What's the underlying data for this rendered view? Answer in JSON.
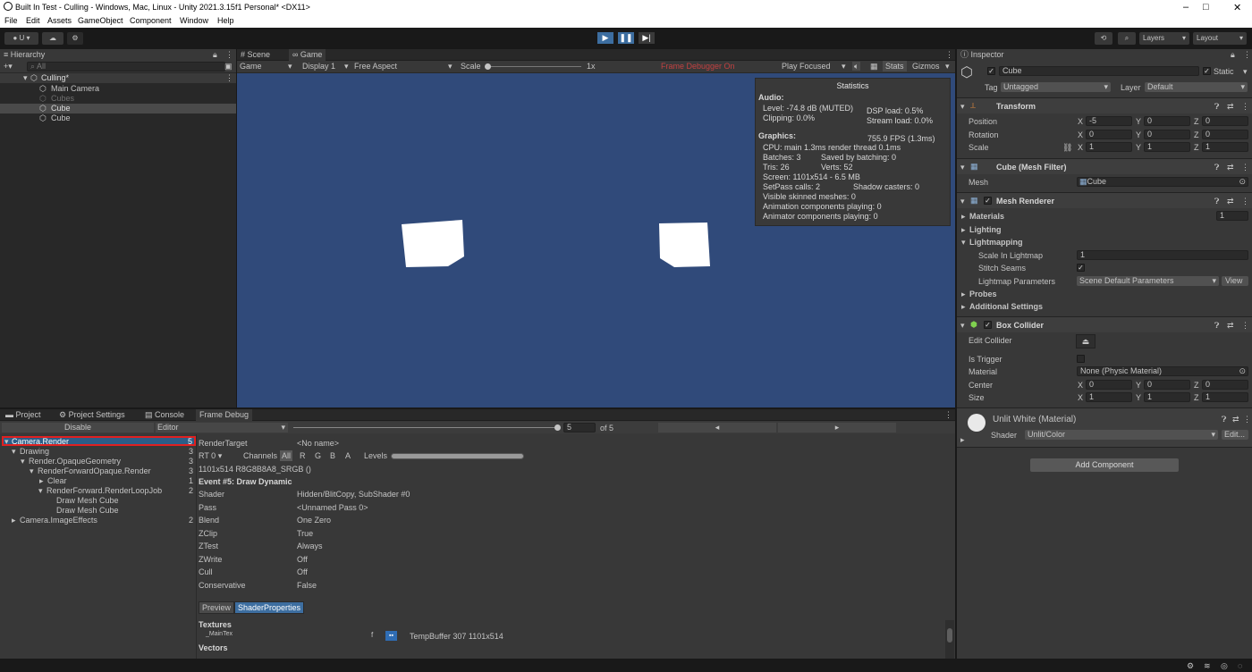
{
  "window": {
    "title": "Built In Test - Culling - Windows, Mac, Linux - Unity 2021.3.15f1 Personal* <DX11>",
    "minimize": "–",
    "maximize": "□",
    "close": "✕"
  },
  "menu": [
    "File",
    "Edit",
    "Assets",
    "GameObject",
    "Component",
    "Window",
    "Help"
  ],
  "toolbar": {
    "account": "U ▾",
    "layers": "Layers",
    "layout": "Layout"
  },
  "hierarchy": {
    "tab": "Hierarchy",
    "search_placeholder": "All",
    "scene": "Culling*",
    "items": [
      "Main Camera",
      "Cubes",
      "Cube",
      "Cube"
    ]
  },
  "game": {
    "tabs": [
      "Scene",
      "Game"
    ],
    "display_mode": "Game",
    "display": "Display 1",
    "aspect": "Free Aspect",
    "scale_label": "Scale",
    "scale_value": "1x",
    "frame_debugger": "Frame Debugger On",
    "play_focused": "Play Focused",
    "stats_btn": "Stats",
    "gizmos_btn": "Gizmos",
    "bg_color": "#304a7a"
  },
  "stats": {
    "title": "Statistics",
    "audio_h": "Audio:",
    "level": "Level: -74.8 dB (MUTED)",
    "clipping": "Clipping: 0.0%",
    "dsp": "DSP load: 0.5%",
    "stream": "Stream load: 0.0%",
    "graphics_h": "Graphics:",
    "fps": "755.9 FPS (1.3ms)",
    "cpu": "CPU: main 1.3ms  render thread 0.1ms",
    "batches": "Batches: 3",
    "saved": "Saved by batching: 0",
    "tris": "Tris: 26",
    "verts": "Verts: 52",
    "screen": "Screen: 1101x514 - 6.5 MB",
    "setpass": "SetPass calls: 2",
    "shadow": "Shadow casters: 0",
    "skinned": "Visible skinned meshes: 0",
    "anim": "Animation components playing: 0",
    "animator": "Animator components playing: 0"
  },
  "bottom_tabs": [
    "Project",
    "Project Settings",
    "Console",
    "Frame Debug"
  ],
  "frame_debug": {
    "disable": "Disable",
    "editor": "Editor",
    "slider_value": "5",
    "of_total": "of 5",
    "prev": "◂",
    "next": "▸",
    "tree": [
      {
        "label": "Camera.Render",
        "count": "5"
      },
      {
        "label": "Drawing",
        "count": "3"
      },
      {
        "label": "Render.OpaqueGeometry",
        "count": "3"
      },
      {
        "label": "RenderForwardOpaque.Render",
        "count": "3"
      },
      {
        "label": "Clear",
        "count": "1"
      },
      {
        "label": "RenderForward.RenderLoopJob",
        "count": "2"
      },
      {
        "label": "Draw Mesh Cube",
        "count": ""
      },
      {
        "label": "Draw Mesh Cube",
        "count": ""
      },
      {
        "label": "Camera.ImageEffects",
        "count": "2"
      }
    ],
    "rendertarget_label": "RenderTarget",
    "rendertarget_value": "<No name>",
    "rt": "RT 0",
    "channels": "Channels",
    "ch_all": "All",
    "ch_r": "R",
    "ch_g": "G",
    "ch_b": "B",
    "ch_a": "A",
    "levels": "Levels",
    "format": "1101x514 R8G8B8A8_SRGB ()",
    "event": "Event #5: Draw Dynamic",
    "props": [
      {
        "k": "Shader",
        "v": "Hidden/BlitCopy, SubShader #0"
      },
      {
        "k": "Pass",
        "v": "<Unnamed Pass 0>"
      },
      {
        "k": "Blend",
        "v": "One Zero"
      },
      {
        "k": "ZClip",
        "v": "True"
      },
      {
        "k": "ZTest",
        "v": "Always"
      },
      {
        "k": "ZWrite",
        "v": "Off"
      },
      {
        "k": "Cull",
        "v": "Off"
      },
      {
        "k": "Conservative",
        "v": "False"
      }
    ],
    "preview_tab": "Preview",
    "shaderprops_tab": "ShaderProperties",
    "textures_h": "Textures",
    "maintex": "_MainTex",
    "maintex_f": "f",
    "maintex_value": "TempBuffer 307 1101x514",
    "vectors_h": "Vectors"
  },
  "inspector": {
    "tab": "Inspector",
    "name": "Cube",
    "static": "Static",
    "tag_label": "Tag",
    "tag": "Untagged",
    "layer_label": "Layer",
    "layer": "Default",
    "transform": {
      "title": "Transform",
      "rows": [
        {
          "label": "Position",
          "x": "-5",
          "y": "0",
          "z": "0"
        },
        {
          "label": "Rotation",
          "x": "0",
          "y": "0",
          "z": "0"
        },
        {
          "label": "Scale",
          "x": "1",
          "y": "1",
          "z": "1"
        }
      ]
    },
    "mesh_filter": {
      "title": "Cube (Mesh Filter)",
      "mesh_label": "Mesh",
      "mesh": "Cube"
    },
    "mesh_renderer": {
      "title": "Mesh Renderer",
      "materials": "Materials",
      "materials_count": "1",
      "lighting": "Lighting",
      "lightmapping": "Lightmapping",
      "scale_label": "Scale In Lightmap",
      "scale_value": "1",
      "stitch": "Stitch Seams",
      "params_label": "Lightmap Parameters",
      "params_value": "Scene Default Parameters",
      "view": "View",
      "probes": "Probes",
      "additional": "Additional Settings"
    },
    "box_collider": {
      "title": "Box Collider",
      "edit": "Edit Collider",
      "trigger": "Is Trigger",
      "material_label": "Material",
      "material": "None (Physic Material)",
      "center": {
        "label": "Center",
        "x": "0",
        "y": "0",
        "z": "0"
      },
      "size": {
        "label": "Size",
        "x": "1",
        "y": "1",
        "z": "1"
      }
    },
    "material": {
      "title": "Unlit White (Material)",
      "shader_label": "Shader",
      "shader": "Unlit/Color",
      "edit": "Edit..."
    },
    "add_component": "Add Component"
  }
}
